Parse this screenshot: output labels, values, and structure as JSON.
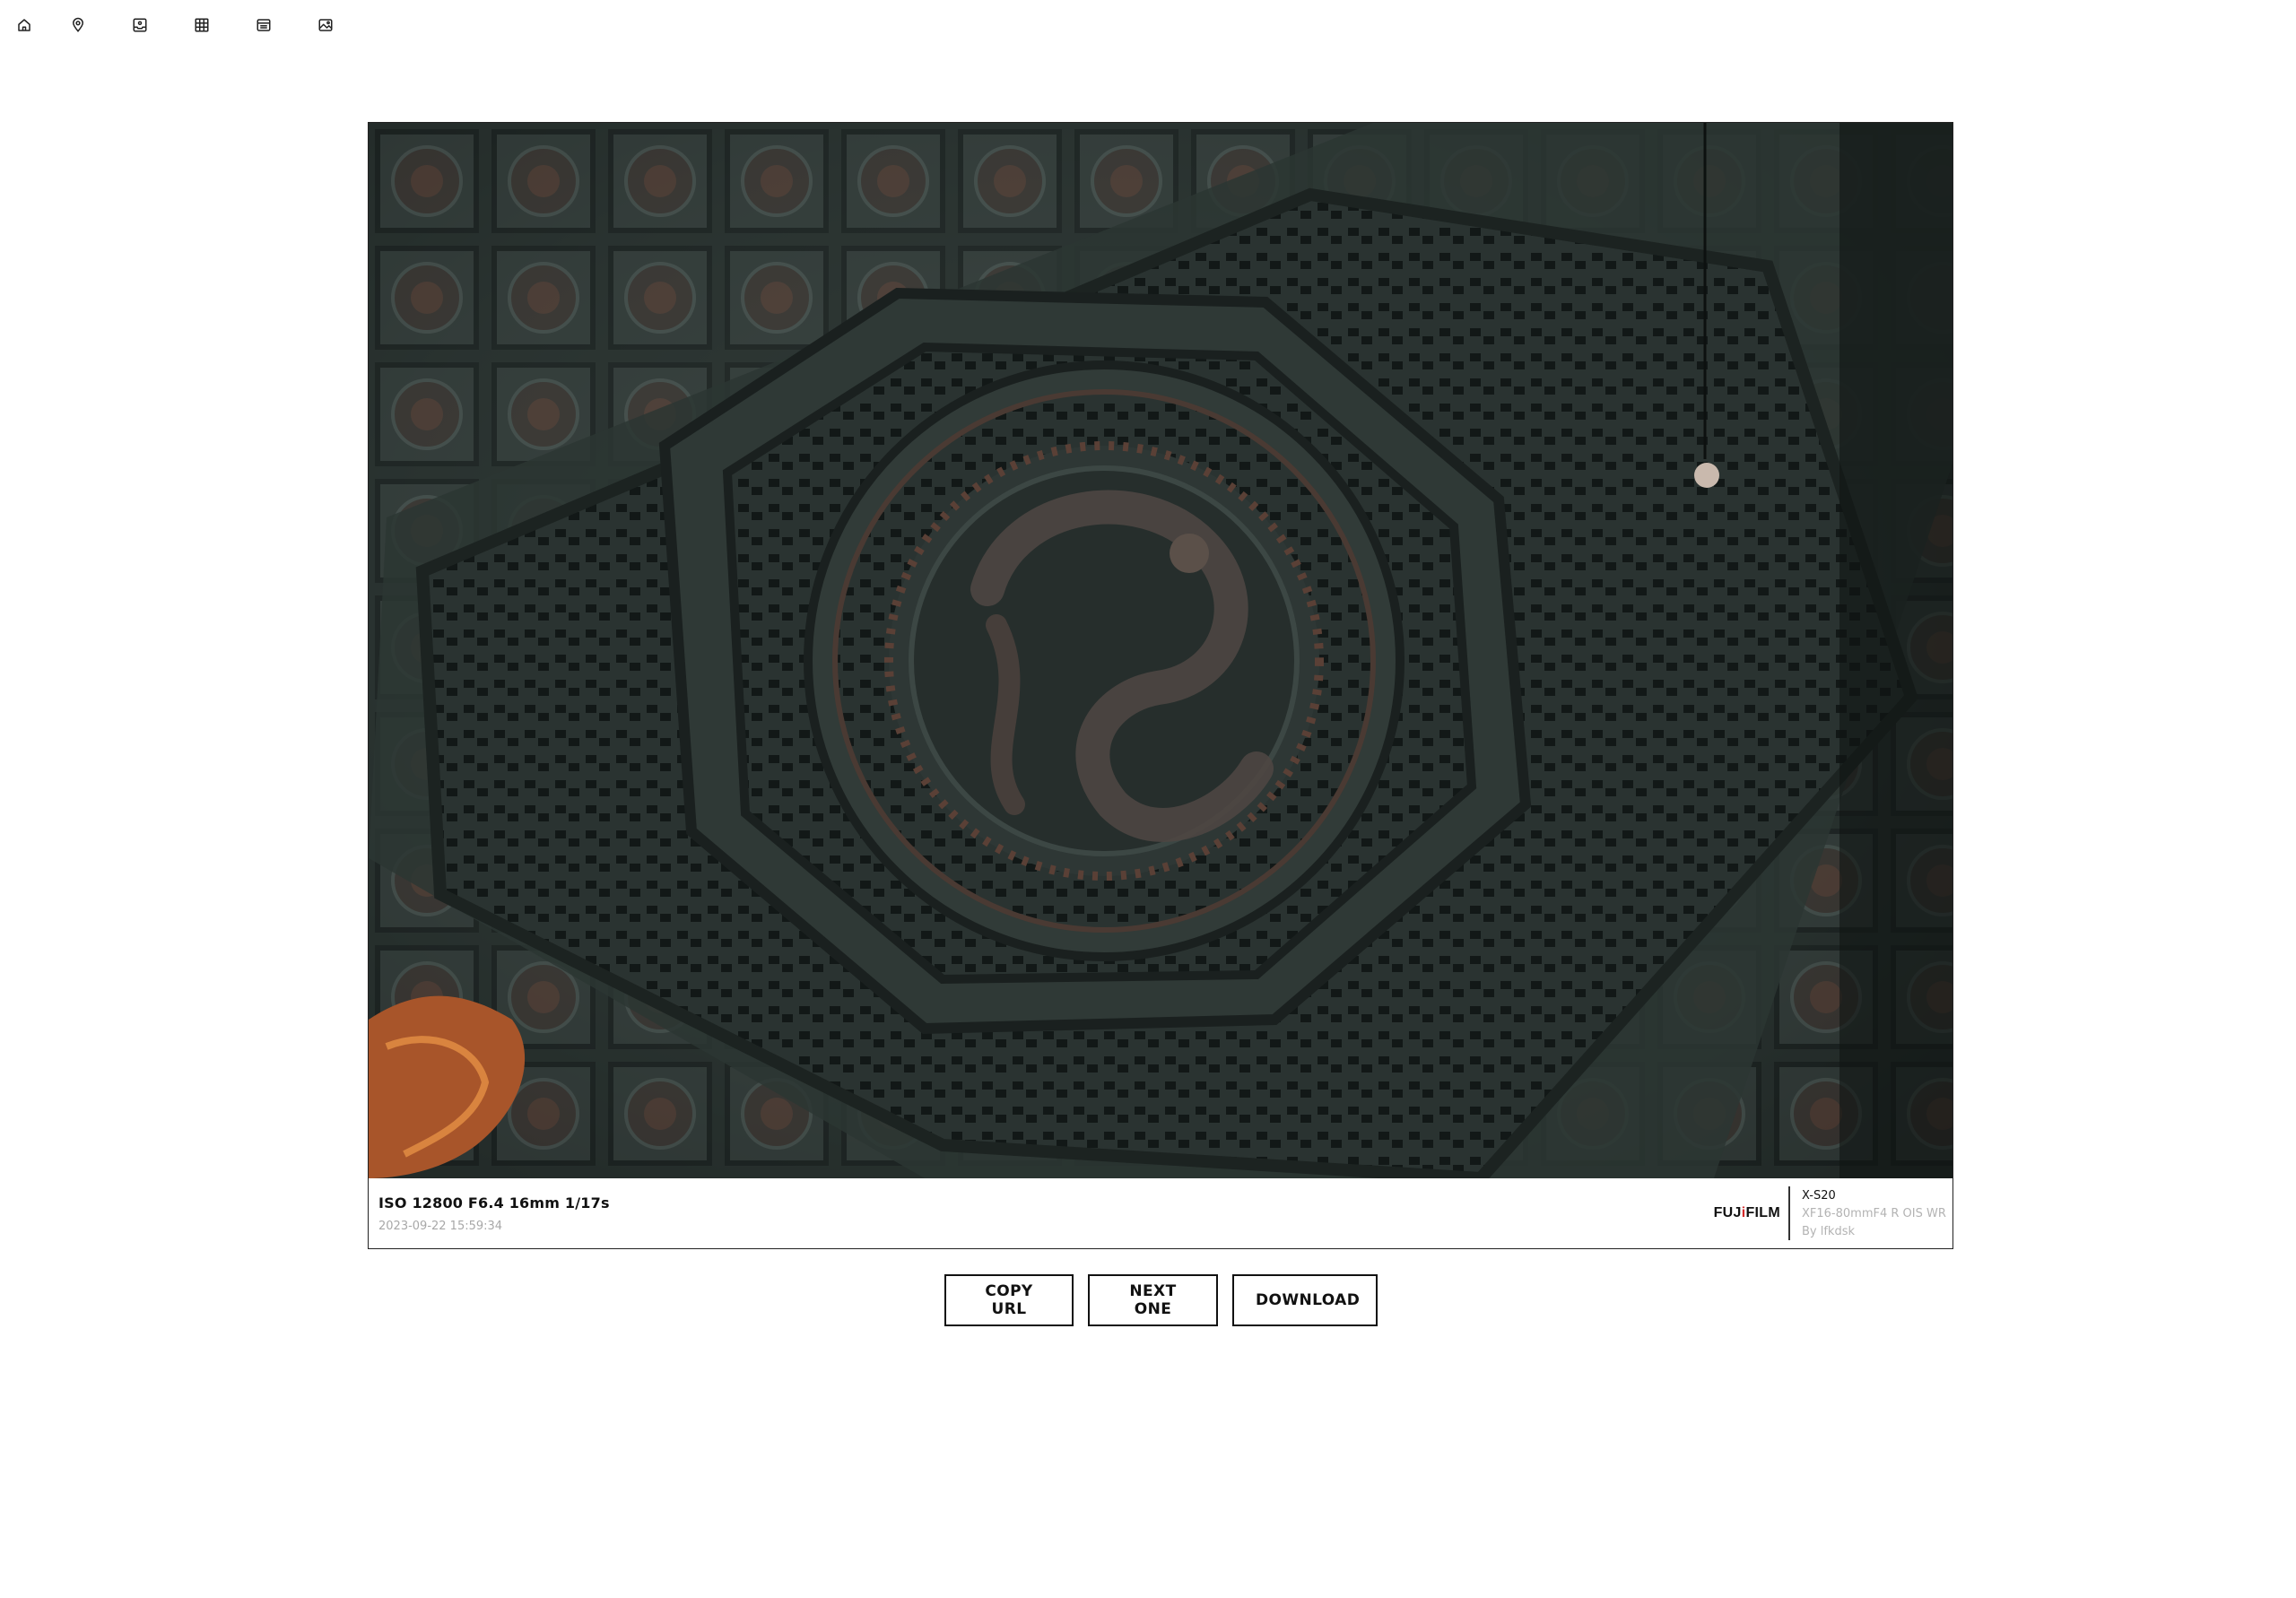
{
  "nav": {
    "items": [
      {
        "icon": "home-icon"
      },
      {
        "icon": "map-pin-icon"
      },
      {
        "icon": "inbox-photo-icon"
      },
      {
        "icon": "grid-icon"
      },
      {
        "icon": "list-icon"
      },
      {
        "icon": "image-icon"
      }
    ]
  },
  "photo": {
    "subject": "carved dragon caisson ceiling"
  },
  "exif": {
    "params": "ISO 12800 F6.4 16mm 1/17s",
    "date": "2023-09-22 15:59:34",
    "brand_prefix": "FUJ",
    "brand_i": "i",
    "brand_suffix": "FILM",
    "camera_model": "X-S20",
    "lens_model": "XF16-80mmF4 R OIS WR",
    "author": "By lfkdsk"
  },
  "actions": {
    "copy_label": "COPY URL",
    "next_label": "NEXT ONE",
    "download_label": "DOWNLOAD"
  },
  "colors": {
    "brand_accent": "#d42a2a",
    "text": "#111111",
    "muted": "#a8a8a8"
  }
}
